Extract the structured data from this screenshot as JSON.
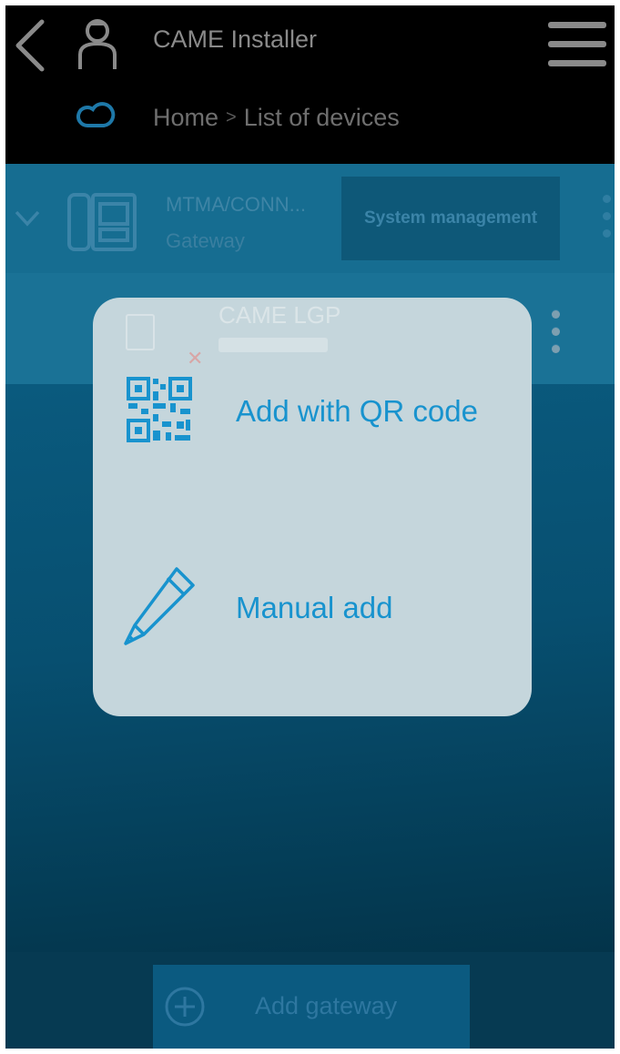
{
  "header": {
    "app_title": "CAME Installer",
    "breadcrumb": [
      "Home",
      "List of devices"
    ],
    "icons": [
      "back-icon",
      "user-icon",
      "menu-icon",
      "cloud-icon"
    ]
  },
  "device_list": {
    "gateway": {
      "name": "MTMA/CONN...",
      "type": "Gateway",
      "system_button": "System management"
    },
    "device": {
      "name": "CAME LGP"
    }
  },
  "popup": {
    "options": [
      {
        "label": "Add with QR code",
        "icon": "qr-code-icon"
      },
      {
        "label": "Manual add",
        "icon": "pencil-icon"
      }
    ]
  },
  "footer": {
    "add_gateway_label": "Add gateway"
  },
  "colors": {
    "topbar": "#000000",
    "list_bg": "#0a5f86",
    "popup_bg": "#c5d6dc",
    "accent": "#1893ce"
  }
}
